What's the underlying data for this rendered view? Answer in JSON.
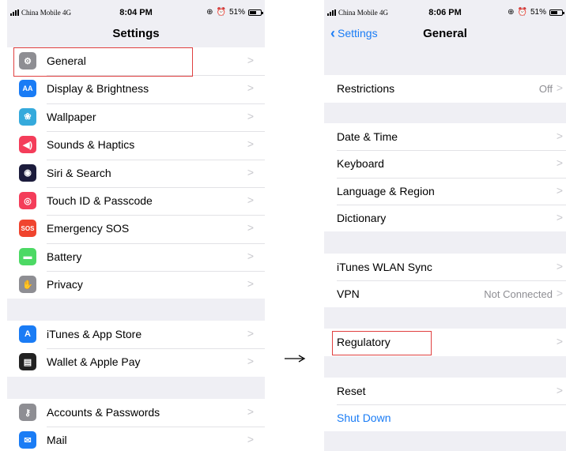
{
  "left": {
    "status": {
      "carrier": "China Mobile 4G",
      "time": "8:04 PM",
      "battery": "51%"
    },
    "title": "Settings",
    "group1": [
      {
        "label": "General",
        "icon": "gear-icon",
        "color": "#8e8e93"
      },
      {
        "label": "Display & Brightness",
        "icon": "display-icon",
        "color": "#1a7cf5"
      },
      {
        "label": "Wallpaper",
        "icon": "wallpaper-icon",
        "color": "#35aadc"
      },
      {
        "label": "Sounds & Haptics",
        "icon": "speaker-icon",
        "color": "#f43d5a"
      },
      {
        "label": "Siri & Search",
        "icon": "siri-icon",
        "color": "#1c1c3c"
      },
      {
        "label": "Touch ID & Passcode",
        "icon": "fingerprint-icon",
        "color": "#f43d5a"
      },
      {
        "label": "Emergency SOS",
        "icon": "sos-icon",
        "icon_text": "SOS",
        "color": "#f0442e"
      },
      {
        "label": "Battery",
        "icon": "battery-icon",
        "color": "#4cd964"
      },
      {
        "label": "Privacy",
        "icon": "hand-icon",
        "color": "#8e8e93"
      }
    ],
    "group2": [
      {
        "label": "iTunes & App Store",
        "icon": "app-store-icon",
        "color": "#1a7cf5"
      },
      {
        "label": "Wallet & Apple Pay",
        "icon": "wallet-icon",
        "color": "#222222"
      }
    ],
    "group3": [
      {
        "label": "Accounts & Passwords",
        "icon": "key-icon",
        "color": "#8e8e93"
      },
      {
        "label": "Mail",
        "icon": "mail-icon",
        "color": "#1a7cf5"
      }
    ]
  },
  "right": {
    "status": {
      "carrier": "China Mobile 4G",
      "time": "8:06 PM",
      "battery": "51%"
    },
    "back_label": "Settings",
    "title": "General",
    "restrictions": {
      "label": "Restrictions",
      "value": "Off"
    },
    "group_dt": [
      "Date & Time",
      "Keyboard",
      "Language & Region",
      "Dictionary"
    ],
    "sync": {
      "label": "iTunes WLAN Sync"
    },
    "vpn": {
      "label": "VPN",
      "value": "Not Connected"
    },
    "regulatory": {
      "label": "Regulatory"
    },
    "reset": {
      "label": "Reset"
    },
    "shutdown": {
      "label": "Shut Down",
      "color": "#1a7cf5"
    }
  },
  "chevron": ">",
  "highlight_color": "#e04040"
}
